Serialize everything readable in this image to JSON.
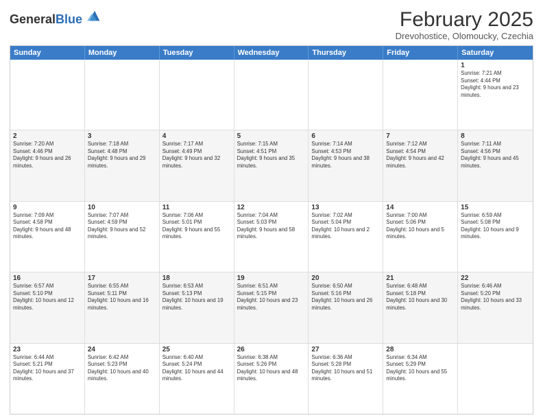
{
  "logo": {
    "general": "General",
    "blue": "Blue"
  },
  "title": {
    "month_year": "February 2025",
    "location": "Drevohostice, Olomoucky, Czechia"
  },
  "header_days": [
    "Sunday",
    "Monday",
    "Tuesday",
    "Wednesday",
    "Thursday",
    "Friday",
    "Saturday"
  ],
  "weeks": [
    [
      {
        "day": "",
        "info": ""
      },
      {
        "day": "",
        "info": ""
      },
      {
        "day": "",
        "info": ""
      },
      {
        "day": "",
        "info": ""
      },
      {
        "day": "",
        "info": ""
      },
      {
        "day": "",
        "info": ""
      },
      {
        "day": "1",
        "info": "Sunrise: 7:21 AM\nSunset: 4:44 PM\nDaylight: 9 hours and 23 minutes."
      }
    ],
    [
      {
        "day": "2",
        "info": "Sunrise: 7:20 AM\nSunset: 4:46 PM\nDaylight: 9 hours and 26 minutes."
      },
      {
        "day": "3",
        "info": "Sunrise: 7:18 AM\nSunset: 4:48 PM\nDaylight: 9 hours and 29 minutes."
      },
      {
        "day": "4",
        "info": "Sunrise: 7:17 AM\nSunset: 4:49 PM\nDaylight: 9 hours and 32 minutes."
      },
      {
        "day": "5",
        "info": "Sunrise: 7:15 AM\nSunset: 4:51 PM\nDaylight: 9 hours and 35 minutes."
      },
      {
        "day": "6",
        "info": "Sunrise: 7:14 AM\nSunset: 4:53 PM\nDaylight: 9 hours and 38 minutes."
      },
      {
        "day": "7",
        "info": "Sunrise: 7:12 AM\nSunset: 4:54 PM\nDaylight: 9 hours and 42 minutes."
      },
      {
        "day": "8",
        "info": "Sunrise: 7:11 AM\nSunset: 4:56 PM\nDaylight: 9 hours and 45 minutes."
      }
    ],
    [
      {
        "day": "9",
        "info": "Sunrise: 7:09 AM\nSunset: 4:58 PM\nDaylight: 9 hours and 48 minutes."
      },
      {
        "day": "10",
        "info": "Sunrise: 7:07 AM\nSunset: 4:59 PM\nDaylight: 9 hours and 52 minutes."
      },
      {
        "day": "11",
        "info": "Sunrise: 7:06 AM\nSunset: 5:01 PM\nDaylight: 9 hours and 55 minutes."
      },
      {
        "day": "12",
        "info": "Sunrise: 7:04 AM\nSunset: 5:03 PM\nDaylight: 9 hours and 58 minutes."
      },
      {
        "day": "13",
        "info": "Sunrise: 7:02 AM\nSunset: 5:04 PM\nDaylight: 10 hours and 2 minutes."
      },
      {
        "day": "14",
        "info": "Sunrise: 7:00 AM\nSunset: 5:06 PM\nDaylight: 10 hours and 5 minutes."
      },
      {
        "day": "15",
        "info": "Sunrise: 6:59 AM\nSunset: 5:08 PM\nDaylight: 10 hours and 9 minutes."
      }
    ],
    [
      {
        "day": "16",
        "info": "Sunrise: 6:57 AM\nSunset: 5:10 PM\nDaylight: 10 hours and 12 minutes."
      },
      {
        "day": "17",
        "info": "Sunrise: 6:55 AM\nSunset: 5:11 PM\nDaylight: 10 hours and 16 minutes."
      },
      {
        "day": "18",
        "info": "Sunrise: 6:53 AM\nSunset: 5:13 PM\nDaylight: 10 hours and 19 minutes."
      },
      {
        "day": "19",
        "info": "Sunrise: 6:51 AM\nSunset: 5:15 PM\nDaylight: 10 hours and 23 minutes."
      },
      {
        "day": "20",
        "info": "Sunrise: 6:50 AM\nSunset: 5:16 PM\nDaylight: 10 hours and 26 minutes."
      },
      {
        "day": "21",
        "info": "Sunrise: 6:48 AM\nSunset: 5:18 PM\nDaylight: 10 hours and 30 minutes."
      },
      {
        "day": "22",
        "info": "Sunrise: 6:46 AM\nSunset: 5:20 PM\nDaylight: 10 hours and 33 minutes."
      }
    ],
    [
      {
        "day": "23",
        "info": "Sunrise: 6:44 AM\nSunset: 5:21 PM\nDaylight: 10 hours and 37 minutes."
      },
      {
        "day": "24",
        "info": "Sunrise: 6:42 AM\nSunset: 5:23 PM\nDaylight: 10 hours and 40 minutes."
      },
      {
        "day": "25",
        "info": "Sunrise: 6:40 AM\nSunset: 5:24 PM\nDaylight: 10 hours and 44 minutes."
      },
      {
        "day": "26",
        "info": "Sunrise: 6:38 AM\nSunset: 5:26 PM\nDaylight: 10 hours and 48 minutes."
      },
      {
        "day": "27",
        "info": "Sunrise: 6:36 AM\nSunset: 5:28 PM\nDaylight: 10 hours and 51 minutes."
      },
      {
        "day": "28",
        "info": "Sunrise: 6:34 AM\nSunset: 5:29 PM\nDaylight: 10 hours and 55 minutes."
      },
      {
        "day": "",
        "info": ""
      }
    ]
  ]
}
